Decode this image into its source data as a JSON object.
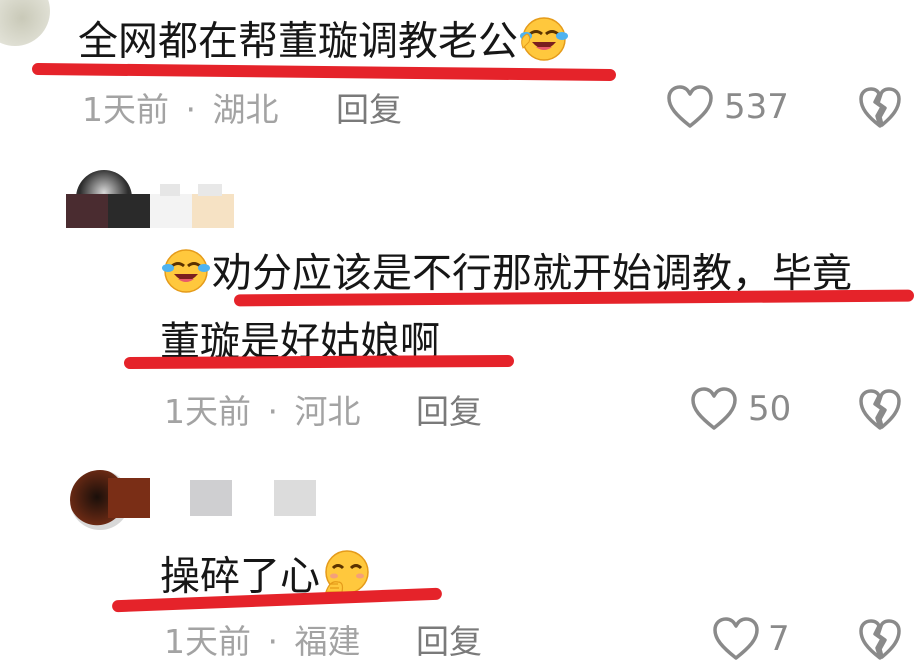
{
  "comments": [
    {
      "text": "全网都在帮董璇调教老公",
      "emoji_icon": "laughing-crying-face-icon",
      "time": "1天前",
      "location": "湖北",
      "reply_label": "回复",
      "likes": "537"
    },
    {
      "text_line1": "劝分应该是不行那就开始调教，毕竟",
      "text_line2": "董璇是好姑娘啊",
      "emoji_icon": "laughing-crying-face-icon",
      "time": "1天前",
      "location": "河北",
      "reply_label": "回复",
      "likes": "50"
    },
    {
      "text": "操碎了心",
      "emoji_icon": "giggling-face-icon",
      "time": "1天前",
      "location": "福建",
      "reply_label": "回复",
      "likes": "7"
    }
  ],
  "separator": "·",
  "colors": {
    "underline": "#e5232a",
    "meta": "#a3a3a3",
    "text": "#161616"
  }
}
